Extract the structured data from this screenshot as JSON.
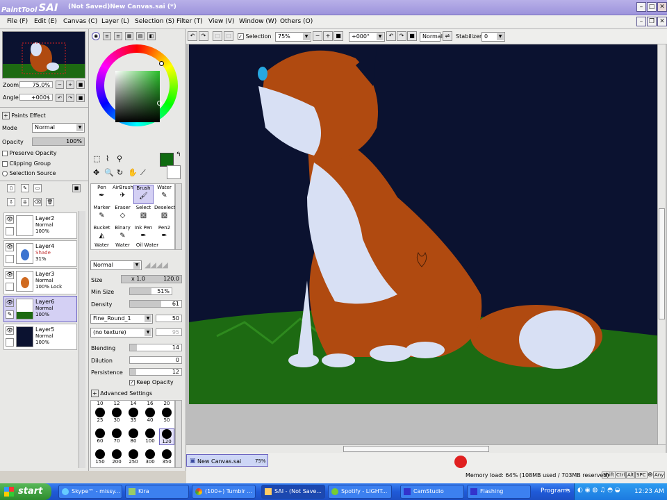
{
  "window": {
    "logo_text": "PaintTool",
    "logo_big": "SAI",
    "title": "(Not Saved)New Canvas.sai (*)",
    "min_icon": "minimize-icon",
    "max_icon": "maximize-icon",
    "close_icon": "close-icon"
  },
  "menu": [
    "File (F)",
    "Edit (E)",
    "Canvas (C)",
    "Layer (L)",
    "Selection (S)",
    "Filter (T)",
    "View (V)",
    "Window (W)",
    "Others (O)"
  ],
  "navigator": {
    "zoom_label": "Zoom",
    "zoom_value": "75.0%",
    "angle_label": "Angle",
    "angle_value": "+000$"
  },
  "layer_props": {
    "paints_effect": "Paints Effect",
    "mode_label": "Mode",
    "mode_value": "Normal",
    "opacity_label": "Opacity",
    "opacity_value": "100%",
    "opacity_level": 1.0,
    "preserve_opacity": "Preserve Opacity",
    "clipping_group": "Clipping Group",
    "selection_source": "Selection Source"
  },
  "layers": [
    {
      "name": "Layer2",
      "mode": "Normal",
      "opacity": "100%",
      "selected": false
    },
    {
      "name": "Layer4",
      "mode": "Shade",
      "opacity": "31%",
      "selected": false
    },
    {
      "name": "Layer3",
      "mode": "Normal",
      "opacity": "100% Lock",
      "selected": false
    },
    {
      "name": "Layer6",
      "mode": "Normal",
      "opacity": "100%",
      "selected": true
    },
    {
      "name": "Layer5",
      "mode": "Normal",
      "opacity": "100%",
      "selected": false
    }
  ],
  "colors": {
    "primary": "#0f6a10",
    "canvas_bg": "#0b1230",
    "grass": "#1d6a12",
    "fox_orange": "#b04a10",
    "fox_white": "#d8e0f4",
    "accent": "#6c64c0"
  },
  "tools": [
    {
      "label": "Pen",
      "icon": "pen-icon"
    },
    {
      "label": "AirBrush",
      "icon": "airbrush-icon"
    },
    {
      "label": "Brush",
      "icon": "brush-icon",
      "selected": true
    },
    {
      "label": "Water",
      "icon": "water-icon"
    },
    {
      "label": "Marker",
      "icon": "marker-icon"
    },
    {
      "label": "Eraser",
      "icon": "eraser-icon"
    },
    {
      "label": "Select",
      "icon": "select-icon"
    },
    {
      "label": "Deselect",
      "icon": "deselect-icon"
    },
    {
      "label": "Bucket",
      "icon": "bucket-icon"
    },
    {
      "label": "Binary",
      "icon": "binary-icon"
    },
    {
      "label": "Ink Pen",
      "icon": "ink-pen-icon"
    },
    {
      "label": "Pen2",
      "icon": "pen2-icon"
    },
    {
      "label": "Water",
      "icon": "water-icon"
    },
    {
      "label": "Water",
      "icon": "water-icon"
    },
    {
      "label": "Oil Water",
      "icon": "oil-water-icon"
    }
  ],
  "brush": {
    "blend_mode": "Normal",
    "size_label": "Size",
    "size_mult": "x 1.0",
    "size_value": "120.0",
    "minsize_label": "Min Size",
    "minsize_value": "51%",
    "minsize_level": 0.51,
    "density_label": "Density",
    "density_value": "61",
    "density_level": 0.61,
    "shape": "Fine_Round_1",
    "shape_value": "50",
    "texture": "(no texture)",
    "texture_value": "95",
    "blending_label": "Blending",
    "blending_value": "14",
    "blending_level": 0.14,
    "dilution_label": "Dilution",
    "dilution_value": "0",
    "dilution_level": 0,
    "persistence_label": "Persistence",
    "persistence_value": "12",
    "persistence_level": 0.12,
    "keep_opacity": "Keep Opacity",
    "advanced": "Advanced Settings"
  },
  "brush_sizes_top": [
    "10",
    "12",
    "14",
    "16",
    "20"
  ],
  "brush_sizes": [
    "25",
    "30",
    "35",
    "40",
    "50",
    "60",
    "70",
    "80",
    "100",
    "120",
    "150",
    "200",
    "250",
    "300",
    "350"
  ],
  "toolbar": {
    "selection_label": "Selection",
    "zoom_value": "75%",
    "angle_value": "+000°",
    "mode_value": "Normal",
    "stabilizer_label": "Stabilizer",
    "stabilizer_value": "0"
  },
  "status": {
    "tab_name": "New Canvas.sai",
    "tab_zoom": "75%",
    "memory": "Memory load: 64% (108MB used / 703MB reserved)",
    "keys": [
      "Shift",
      "Ctrl",
      "Alt",
      "SPC",
      "Any"
    ]
  },
  "taskbar": {
    "start": "start",
    "tasks": [
      "Skype™ - missy...",
      "Kira",
      "(100+) Tumblr ...",
      "SAI - (Not Save...",
      "Spotify - LIGHT...",
      "CamStudio",
      "Flashing"
    ],
    "programs": "Programs",
    "time": "12:23 AM"
  }
}
